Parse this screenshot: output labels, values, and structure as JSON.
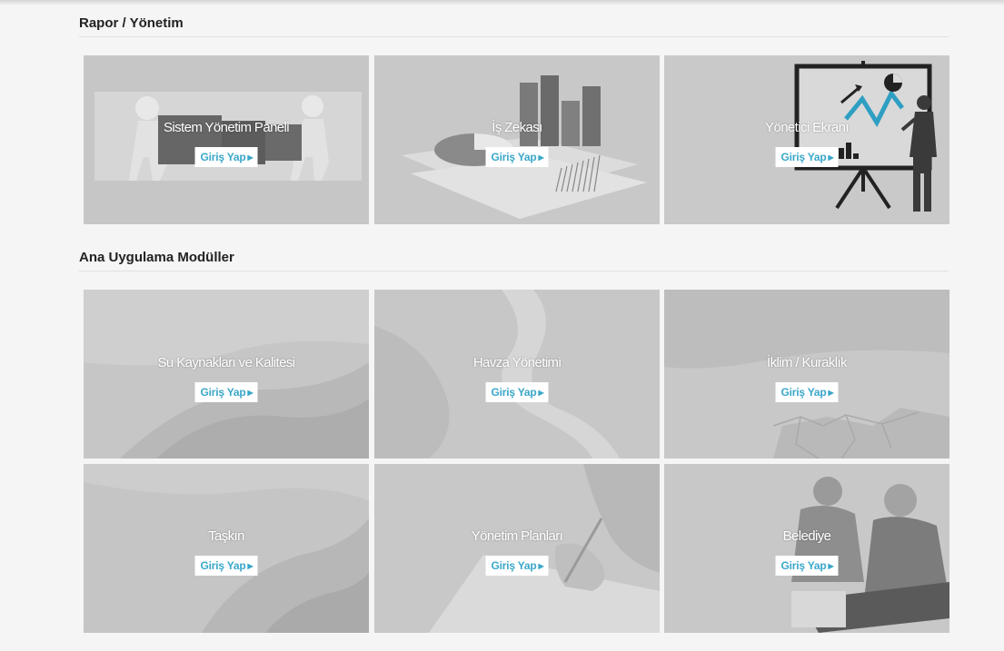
{
  "sections": [
    {
      "title": "Rapor / Yönetim",
      "tiles": [
        {
          "name": "Sistem Yönetim Paneli",
          "button": "Giriş Yap"
        },
        {
          "name": "İş Zekası",
          "button": "Giriş Yap"
        },
        {
          "name": "Yönetici Ekranı",
          "button": "Giriş Yap"
        }
      ]
    },
    {
      "title": "Ana Uygulama Modüller",
      "tiles": [
        {
          "name": "Su Kaynakları ve Kalitesi",
          "button": "Giriş Yap"
        },
        {
          "name": "Havza Yönetimi",
          "button": "Giriş Yap"
        },
        {
          "name": "İklim / Kuraklık",
          "button": "Giriş Yap"
        },
        {
          "name": "Taşkın",
          "button": "Giriş Yap"
        },
        {
          "name": "Yönetim Planları",
          "button": "Giriş Yap"
        },
        {
          "name": "Belediye",
          "button": "Giriş Yap"
        }
      ]
    }
  ],
  "icons": {
    "button_arrow": "caret-right-icon"
  }
}
